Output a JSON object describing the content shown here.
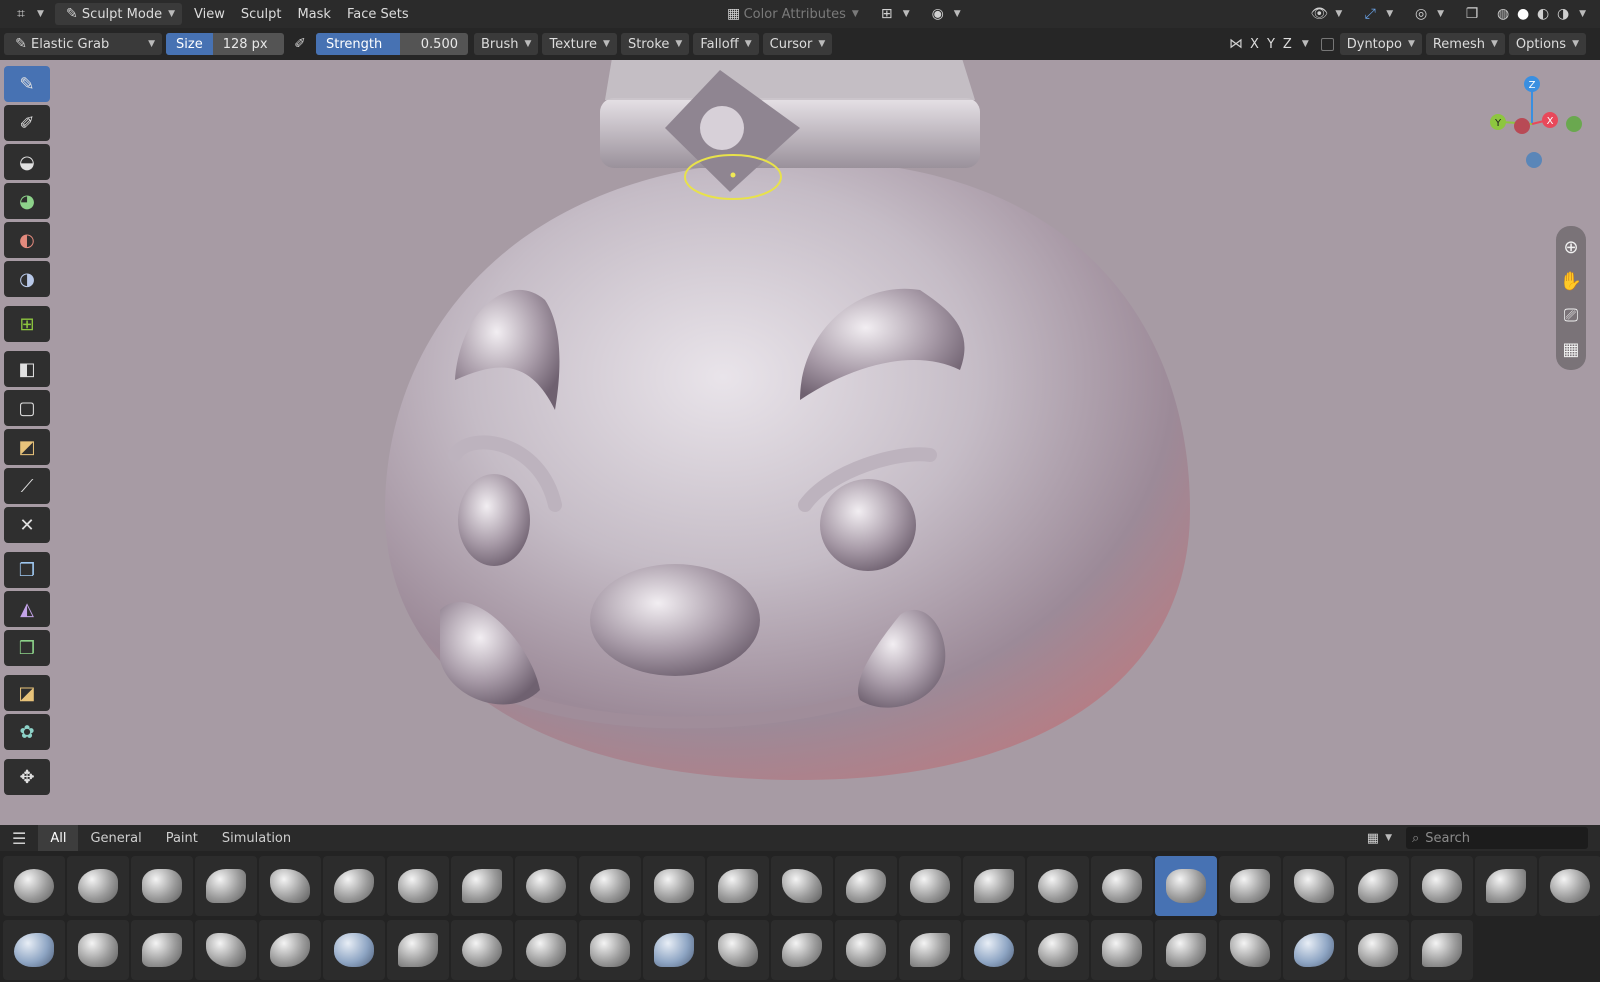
{
  "menubar": {
    "mode_label": "Sculpt Mode",
    "menu_items": [
      "View",
      "Sculpt",
      "Mask",
      "Face Sets"
    ],
    "color_attributes_label": "Color Attributes"
  },
  "tool_header": {
    "brush_name": "Elastic Grab",
    "size_label": "Size",
    "size_value": "128 px",
    "strength_label": "Strength",
    "strength_value": "0.500",
    "dropdowns": [
      "Brush",
      "Texture",
      "Stroke",
      "Falloff",
      "Cursor"
    ],
    "symmetry": [
      "X",
      "Y",
      "Z"
    ],
    "dyntopo_label": "Dyntopo",
    "remesh_label": "Remesh",
    "options_label": "Options"
  },
  "gizmo": {
    "z": "Z",
    "y": "Y",
    "x": "X"
  },
  "asset_shelf": {
    "tabs": [
      "All",
      "General",
      "Paint",
      "Simulation"
    ],
    "search_placeholder": "Search",
    "selected_index": 18
  },
  "colors": {
    "accent": "#4772b3",
    "viewport_bg": "#a79ba4",
    "header_bg": "#262626",
    "axis_x": "#e8485a",
    "axis_y": "#8dc63f",
    "axis_z": "#3a8fe0"
  }
}
